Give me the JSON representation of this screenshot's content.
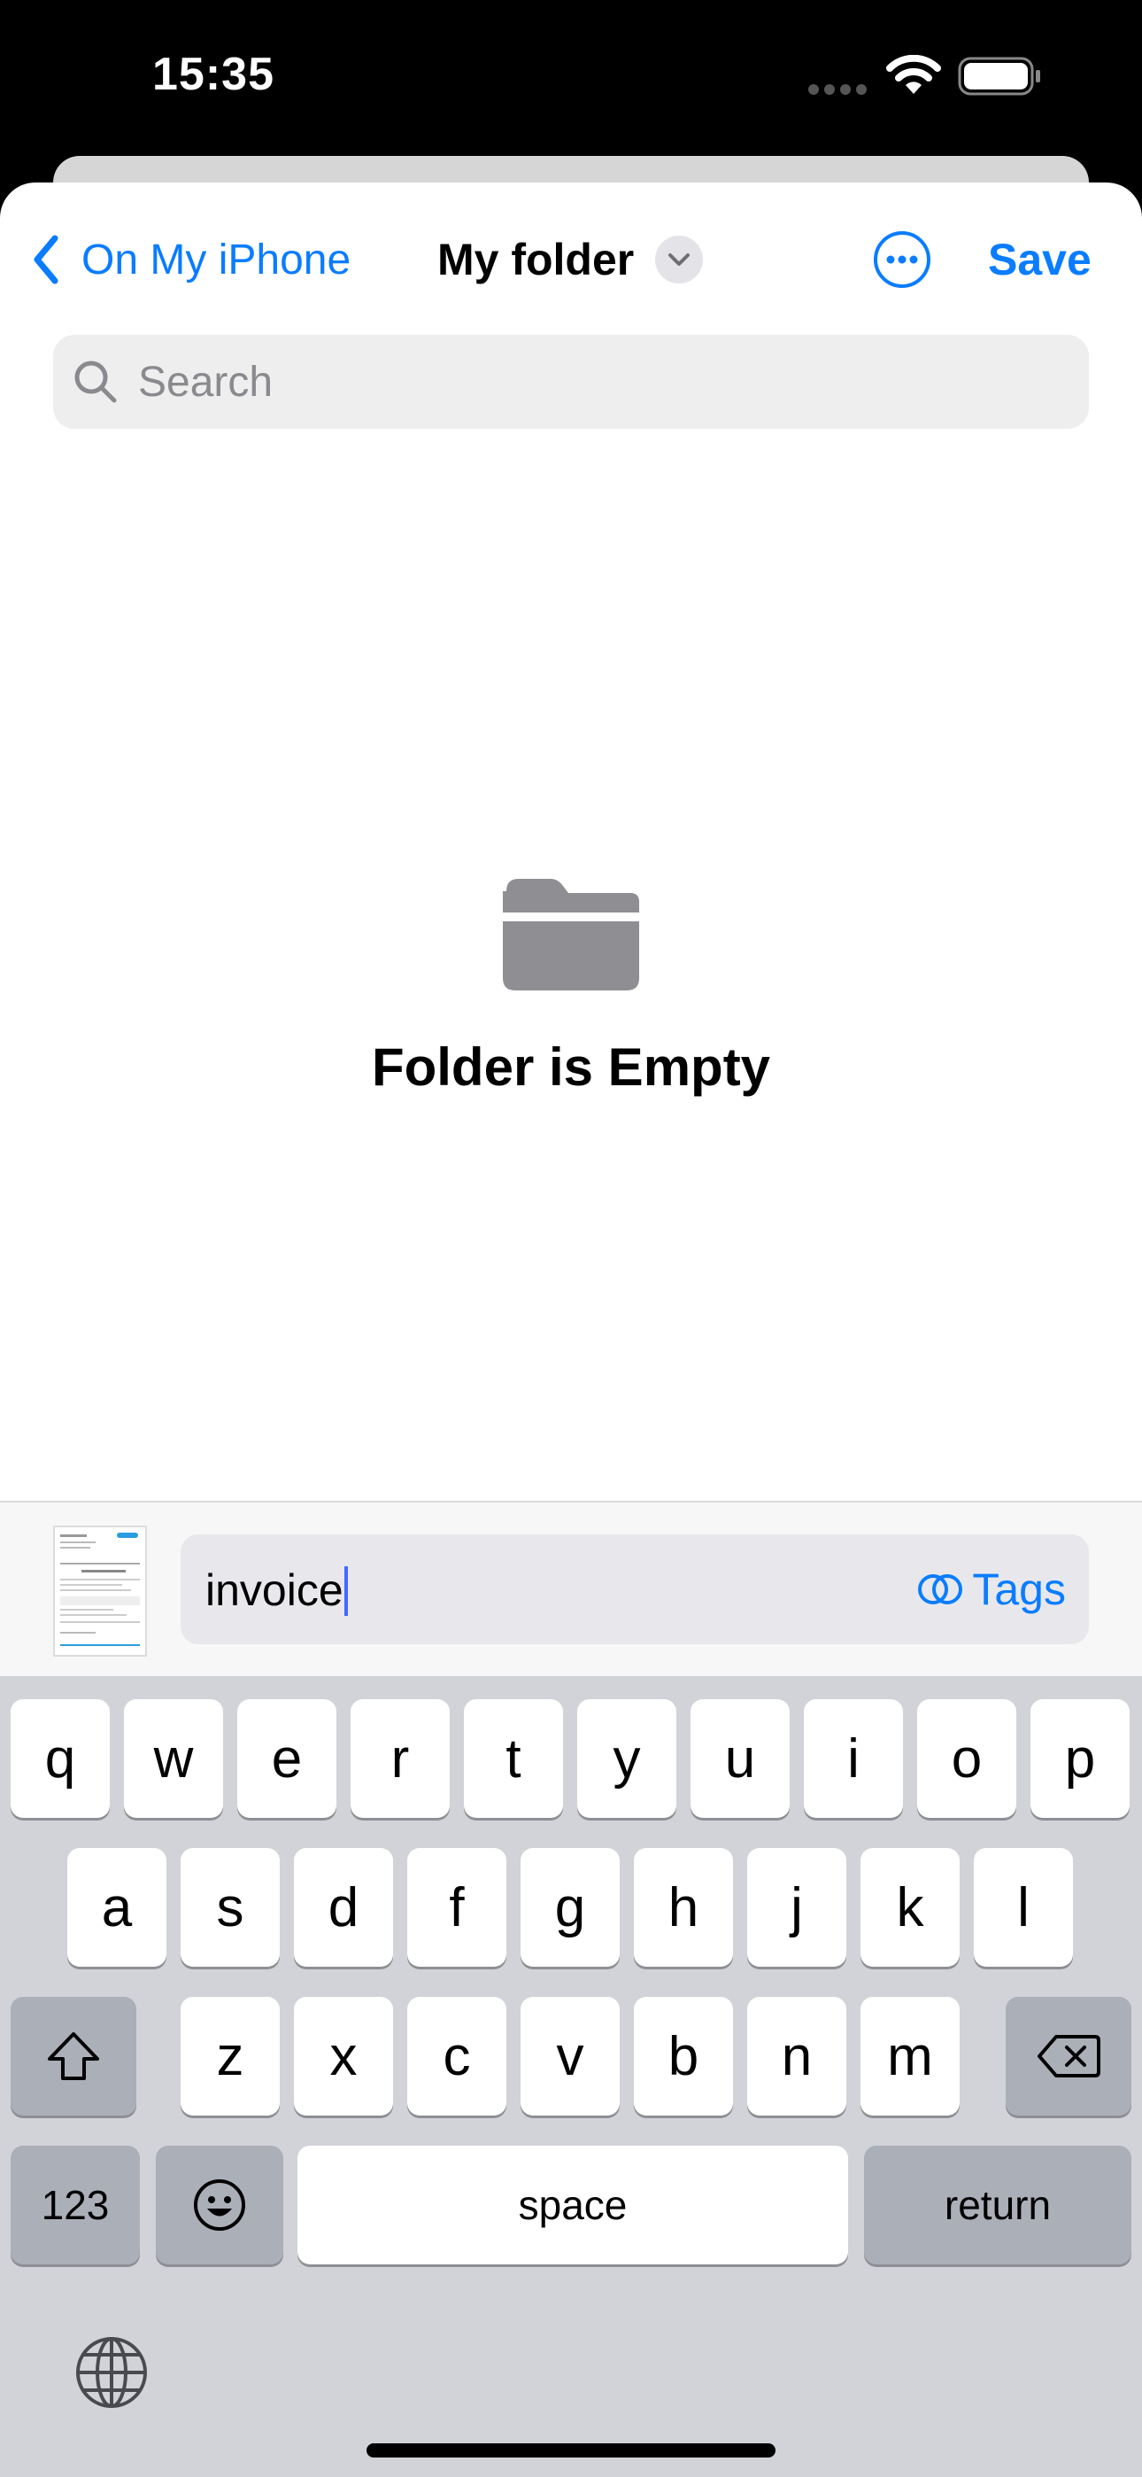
{
  "status": {
    "time": "15:35"
  },
  "nav": {
    "back_label": "On My iPhone",
    "title": "My folder",
    "save_label": "Save"
  },
  "search": {
    "placeholder": "Search"
  },
  "empty": {
    "message": "Folder is Empty"
  },
  "file": {
    "name": "invoice",
    "tags_label": "Tags"
  },
  "keyboard": {
    "row1": [
      "q",
      "w",
      "e",
      "r",
      "t",
      "y",
      "u",
      "i",
      "o",
      "p"
    ],
    "row2": [
      "a",
      "s",
      "d",
      "f",
      "g",
      "h",
      "j",
      "k",
      "l"
    ],
    "row3": [
      "z",
      "x",
      "c",
      "v",
      "b",
      "n",
      "m"
    ],
    "numbers_label": "123",
    "space_label": "space",
    "return_label": "return"
  },
  "colors": {
    "accent": "#0a7cff",
    "folder": "#8e8e93",
    "keyboard_bg": "#d1d3d9"
  }
}
